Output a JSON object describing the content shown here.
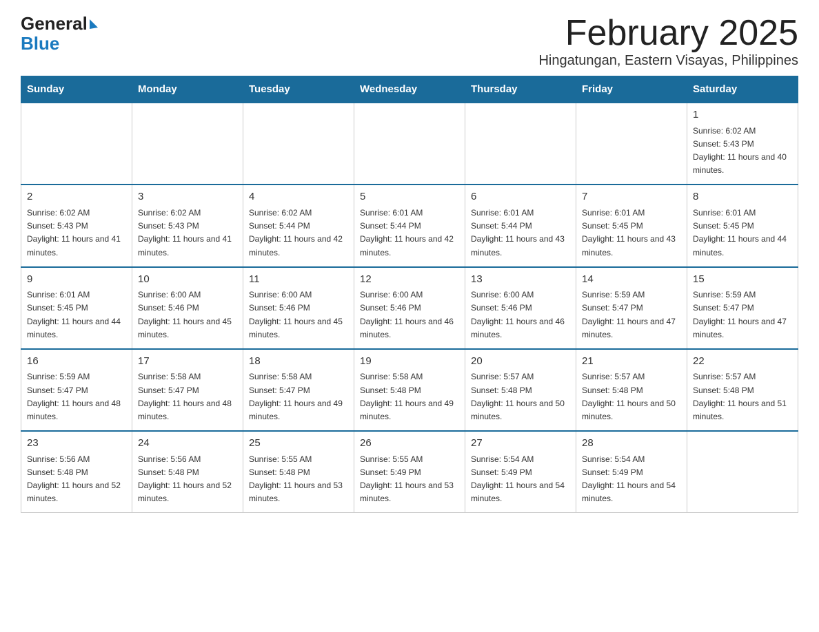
{
  "header": {
    "logo_general": "General",
    "logo_blue": "Blue",
    "title": "February 2025",
    "subtitle": "Hingatungan, Eastern Visayas, Philippines"
  },
  "calendar": {
    "days_of_week": [
      "Sunday",
      "Monday",
      "Tuesday",
      "Wednesday",
      "Thursday",
      "Friday",
      "Saturday"
    ],
    "weeks": [
      [
        {
          "day": "",
          "info": ""
        },
        {
          "day": "",
          "info": ""
        },
        {
          "day": "",
          "info": ""
        },
        {
          "day": "",
          "info": ""
        },
        {
          "day": "",
          "info": ""
        },
        {
          "day": "",
          "info": ""
        },
        {
          "day": "1",
          "info": "Sunrise: 6:02 AM\nSunset: 5:43 PM\nDaylight: 11 hours and 40 minutes."
        }
      ],
      [
        {
          "day": "2",
          "info": "Sunrise: 6:02 AM\nSunset: 5:43 PM\nDaylight: 11 hours and 41 minutes."
        },
        {
          "day": "3",
          "info": "Sunrise: 6:02 AM\nSunset: 5:43 PM\nDaylight: 11 hours and 41 minutes."
        },
        {
          "day": "4",
          "info": "Sunrise: 6:02 AM\nSunset: 5:44 PM\nDaylight: 11 hours and 42 minutes."
        },
        {
          "day": "5",
          "info": "Sunrise: 6:01 AM\nSunset: 5:44 PM\nDaylight: 11 hours and 42 minutes."
        },
        {
          "day": "6",
          "info": "Sunrise: 6:01 AM\nSunset: 5:44 PM\nDaylight: 11 hours and 43 minutes."
        },
        {
          "day": "7",
          "info": "Sunrise: 6:01 AM\nSunset: 5:45 PM\nDaylight: 11 hours and 43 minutes."
        },
        {
          "day": "8",
          "info": "Sunrise: 6:01 AM\nSunset: 5:45 PM\nDaylight: 11 hours and 44 minutes."
        }
      ],
      [
        {
          "day": "9",
          "info": "Sunrise: 6:01 AM\nSunset: 5:45 PM\nDaylight: 11 hours and 44 minutes."
        },
        {
          "day": "10",
          "info": "Sunrise: 6:00 AM\nSunset: 5:46 PM\nDaylight: 11 hours and 45 minutes."
        },
        {
          "day": "11",
          "info": "Sunrise: 6:00 AM\nSunset: 5:46 PM\nDaylight: 11 hours and 45 minutes."
        },
        {
          "day": "12",
          "info": "Sunrise: 6:00 AM\nSunset: 5:46 PM\nDaylight: 11 hours and 46 minutes."
        },
        {
          "day": "13",
          "info": "Sunrise: 6:00 AM\nSunset: 5:46 PM\nDaylight: 11 hours and 46 minutes."
        },
        {
          "day": "14",
          "info": "Sunrise: 5:59 AM\nSunset: 5:47 PM\nDaylight: 11 hours and 47 minutes."
        },
        {
          "day": "15",
          "info": "Sunrise: 5:59 AM\nSunset: 5:47 PM\nDaylight: 11 hours and 47 minutes."
        }
      ],
      [
        {
          "day": "16",
          "info": "Sunrise: 5:59 AM\nSunset: 5:47 PM\nDaylight: 11 hours and 48 minutes."
        },
        {
          "day": "17",
          "info": "Sunrise: 5:58 AM\nSunset: 5:47 PM\nDaylight: 11 hours and 48 minutes."
        },
        {
          "day": "18",
          "info": "Sunrise: 5:58 AM\nSunset: 5:47 PM\nDaylight: 11 hours and 49 minutes."
        },
        {
          "day": "19",
          "info": "Sunrise: 5:58 AM\nSunset: 5:48 PM\nDaylight: 11 hours and 49 minutes."
        },
        {
          "day": "20",
          "info": "Sunrise: 5:57 AM\nSunset: 5:48 PM\nDaylight: 11 hours and 50 minutes."
        },
        {
          "day": "21",
          "info": "Sunrise: 5:57 AM\nSunset: 5:48 PM\nDaylight: 11 hours and 50 minutes."
        },
        {
          "day": "22",
          "info": "Sunrise: 5:57 AM\nSunset: 5:48 PM\nDaylight: 11 hours and 51 minutes."
        }
      ],
      [
        {
          "day": "23",
          "info": "Sunrise: 5:56 AM\nSunset: 5:48 PM\nDaylight: 11 hours and 52 minutes."
        },
        {
          "day": "24",
          "info": "Sunrise: 5:56 AM\nSunset: 5:48 PM\nDaylight: 11 hours and 52 minutes."
        },
        {
          "day": "25",
          "info": "Sunrise: 5:55 AM\nSunset: 5:48 PM\nDaylight: 11 hours and 53 minutes."
        },
        {
          "day": "26",
          "info": "Sunrise: 5:55 AM\nSunset: 5:49 PM\nDaylight: 11 hours and 53 minutes."
        },
        {
          "day": "27",
          "info": "Sunrise: 5:54 AM\nSunset: 5:49 PM\nDaylight: 11 hours and 54 minutes."
        },
        {
          "day": "28",
          "info": "Sunrise: 5:54 AM\nSunset: 5:49 PM\nDaylight: 11 hours and 54 minutes."
        },
        {
          "day": "",
          "info": ""
        }
      ]
    ]
  }
}
